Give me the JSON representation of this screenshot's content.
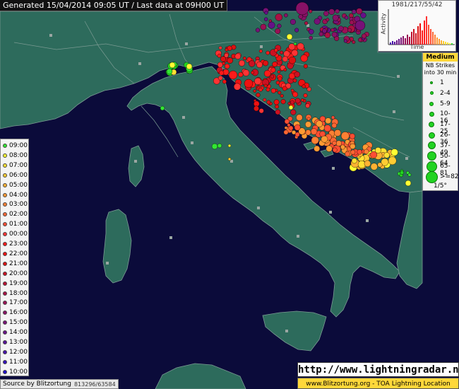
{
  "header": {
    "text": "Generated 15/04/2014 09:05 UT / Last data at 09H00 UT"
  },
  "activity": {
    "title": "1981/217/55/42",
    "xlabel": "Time",
    "ylabel": "Activity"
  },
  "strike_legend": {
    "title": "Medium",
    "subtitle_line1": "NB Strikes",
    "subtitle_line2": "into 30 min",
    "scale_label": "1/5°",
    "rows": [
      {
        "label": "1"
      },
      {
        "label": "2-4"
      },
      {
        "label": "5-9"
      },
      {
        "label": "10-16"
      },
      {
        "label": "17-25"
      },
      {
        "label": "26-36"
      },
      {
        "label": "37-49"
      },
      {
        "label": "50-64"
      },
      {
        "label": "65-81"
      },
      {
        "label": ">=82"
      }
    ]
  },
  "timeline": [
    {
      "time": "09:00",
      "color": "#33e633"
    },
    {
      "time": "08:00",
      "color": "#ffff33"
    },
    {
      "time": "07:00",
      "color": "#ffe033"
    },
    {
      "time": "06:00",
      "color": "#ffcc33"
    },
    {
      "time": "05:00",
      "color": "#ffb233"
    },
    {
      "time": "04:00",
      "color": "#ff9a33"
    },
    {
      "time": "03:00",
      "color": "#ff8033"
    },
    {
      "time": "02:00",
      "color": "#ff6633"
    },
    {
      "time": "01:00",
      "color": "#ff4d33"
    },
    {
      "time": "00:00",
      "color": "#ff3333"
    },
    {
      "time": "23:00",
      "color": "#ff1a1a"
    },
    {
      "time": "22:00",
      "color": "#ee1111"
    },
    {
      "time": "21:00",
      "color": "#dd1111"
    },
    {
      "time": "20:00",
      "color": "#cc1122"
    },
    {
      "time": "19:00",
      "color": "#bb1133"
    },
    {
      "time": "18:00",
      "color": "#aa1144"
    },
    {
      "time": "17:00",
      "color": "#991155"
    },
    {
      "time": "16:00",
      "color": "#881166"
    },
    {
      "time": "15:00",
      "color": "#771177"
    },
    {
      "time": "14:00",
      "color": "#661188"
    },
    {
      "time": "13:00",
      "color": "#551199"
    },
    {
      "time": "12:00",
      "color": "#4411aa"
    },
    {
      "time": "11:00",
      "color": "#3311bb"
    },
    {
      "time": "10:00",
      "color": "#2211cc"
    }
  ],
  "footer": {
    "source_label": "Source by Blitzortung",
    "source_count": "813296/63584",
    "site_url": "http://www.lightningradar.net",
    "credit": "www.Blitzortung.org - TOA Lightning Location"
  },
  "colors": {
    "sea": "#0b0b3a",
    "land": "#2d6b5c",
    "border": "#7a9a92",
    "legend_bg": "#f4f4f4",
    "accent": "#ffd83a",
    "strike_green": "#22d322"
  }
}
